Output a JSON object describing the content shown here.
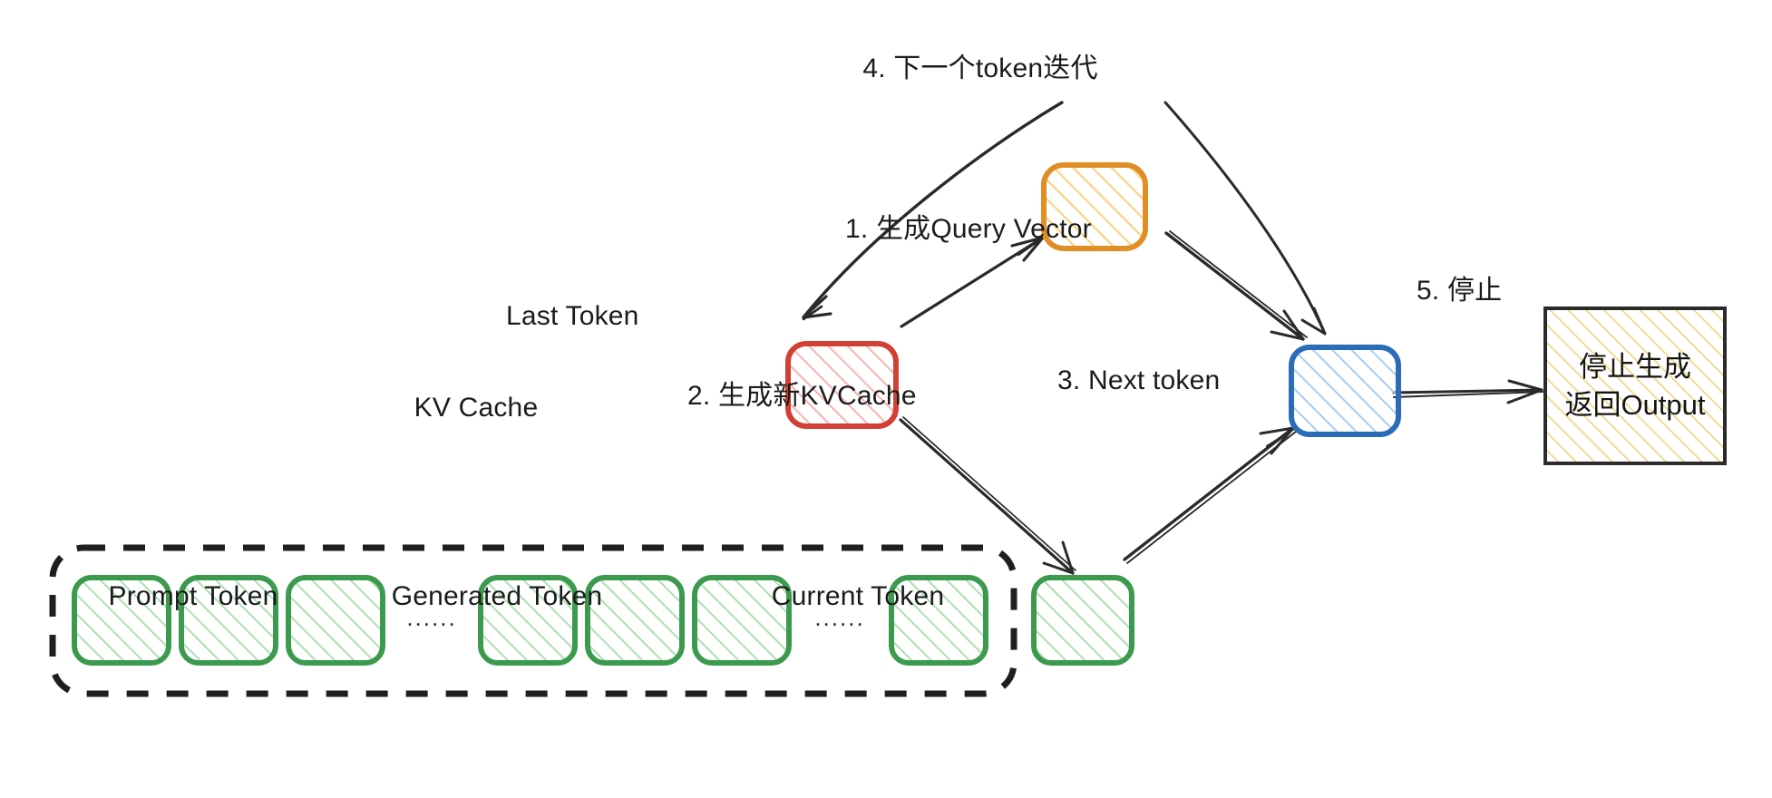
{
  "diagram": {
    "title_present": false,
    "colors": {
      "orange_stroke": "#e08e26",
      "orange_fill": "#fbd38a",
      "red_stroke": "#d23f34",
      "red_fill": "#f3b0ac",
      "blue_stroke": "#2b6cb8",
      "blue_fill": "#9fc6ee",
      "green_stroke": "#3c9a4e",
      "green_fill": "#a9dcab",
      "yellow_fill": "#f2de9a",
      "output_stroke": "#2b2b2b",
      "ink": "#1b1b1b",
      "dashed_stroke": "#1f1f1f"
    }
  },
  "nodes": {
    "query_vector_box": {
      "name": "query-vector-box",
      "color": "orange",
      "label": ""
    },
    "last_token_box": {
      "name": "last-token-box",
      "color": "red",
      "label": ""
    },
    "next_token_box": {
      "name": "next-token-box",
      "color": "blue",
      "label": ""
    },
    "current_token_box": {
      "name": "current-token-box",
      "color": "green",
      "label": ""
    },
    "output_box": {
      "name": "output-box",
      "color": "yellow",
      "line1": "停止生成",
      "line2": "返回Output"
    }
  },
  "labels": {
    "last_token": "Last Token",
    "kv_cache": "KV Cache",
    "prompt_token": "Prompt Token",
    "generated_token": "Generated Token",
    "current_token": "Current Token",
    "ellipsis_1": "......",
    "ellipsis_2": "......"
  },
  "steps": [
    {
      "id": "step-1",
      "text": "1. 生成Query Vector"
    },
    {
      "id": "step-2",
      "text": "2. 生成新KVCache"
    },
    {
      "id": "step-3",
      "text": "3. Next token"
    },
    {
      "id": "step-4",
      "text": "4. 下一个token迭代"
    },
    {
      "id": "step-5",
      "text": "5. 停止"
    }
  ],
  "kv_cache": {
    "prompt_tokens": 3,
    "generated_tokens": 3,
    "trailing_tokens": 1,
    "current_tokens": 1
  }
}
